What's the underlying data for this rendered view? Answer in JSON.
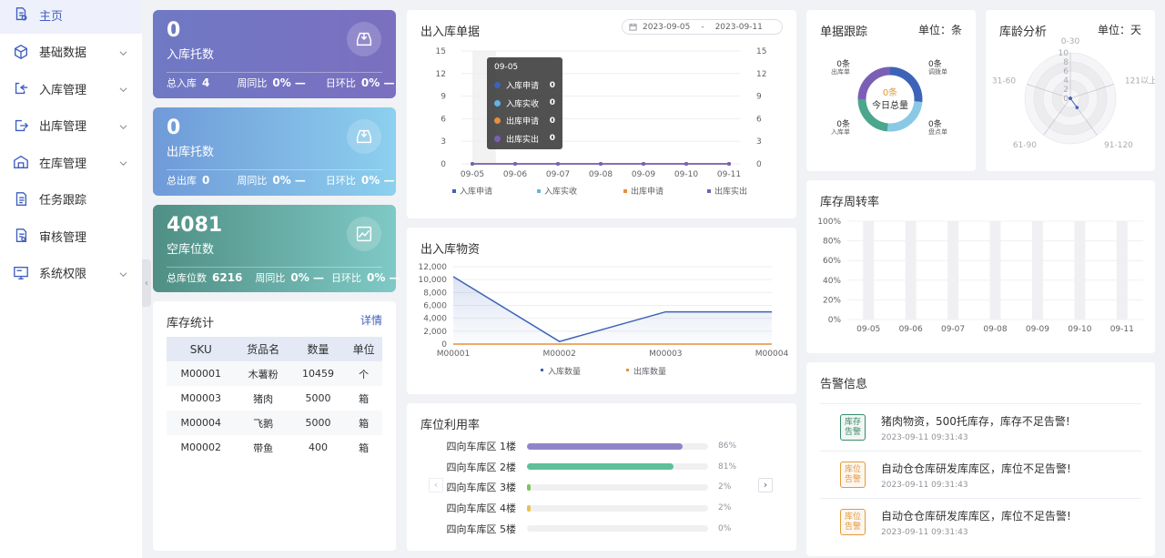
{
  "sidebar": {
    "items": [
      {
        "label": "主页",
        "icon": "home-doc-icon",
        "active": true,
        "has_chevron": false
      },
      {
        "label": "基础数据",
        "icon": "cube-icon",
        "active": false,
        "has_chevron": true
      },
      {
        "label": "入库管理",
        "icon": "inbound-icon",
        "active": false,
        "has_chevron": true
      },
      {
        "label": "出库管理",
        "icon": "outbound-icon",
        "active": false,
        "has_chevron": true
      },
      {
        "label": "在库管理",
        "icon": "warehouse-icon",
        "active": false,
        "has_chevron": true
      },
      {
        "label": "任务跟踪",
        "icon": "task-doc-icon",
        "active": false,
        "has_chevron": false
      },
      {
        "label": "审核管理",
        "icon": "audit-doc-icon",
        "active": false,
        "has_chevron": false
      },
      {
        "label": "系统权限",
        "icon": "system-monitor-icon",
        "active": false,
        "has_chevron": true
      }
    ],
    "collapse_glyph": "‹"
  },
  "stats": {
    "inbound": {
      "value": "0",
      "label": "入库托数",
      "total_label": "总入库",
      "total": "4",
      "wow_label": "周同比",
      "wow": "0% —",
      "dod_label": "日环比",
      "dod": "0% —"
    },
    "outbound": {
      "value": "0",
      "label": "出库托数",
      "total_label": "总出库",
      "total": "0",
      "wow_label": "周同比",
      "wow": "0% —",
      "dod_label": "日环比",
      "dod": "0% —"
    },
    "empty": {
      "value": "4081",
      "label": "空库位数",
      "total_label": "总库位数",
      "total": "6216",
      "wow_label": "周同比",
      "wow": "0% —",
      "dod_label": "日环比",
      "dod": "0% —"
    }
  },
  "inventory": {
    "title": "库存统计",
    "detail": "详情",
    "headers": [
      "SKU",
      "货品名",
      "数量",
      "单位"
    ],
    "rows": [
      [
        "M00001",
        "木薯粉",
        "10459",
        "个"
      ],
      [
        "M00003",
        "猪肉",
        "5000",
        "箱"
      ],
      [
        "M00004",
        "飞鹅",
        "5000",
        "箱"
      ],
      [
        "M00002",
        "带鱼",
        "400",
        "箱"
      ]
    ]
  },
  "doc_chart": {
    "title": "出入库单据",
    "date_start": "2023-09-05",
    "date_sep": "-",
    "date_end": "2023-09-11",
    "tooltip": {
      "date": "09-05",
      "rows": [
        {
          "name": "入库申请",
          "value": "0",
          "color": "#3c63b8"
        },
        {
          "name": "入库实收",
          "value": "0",
          "color": "#5eb5e6"
        },
        {
          "name": "出库申请",
          "value": "0",
          "color": "#e88f3c"
        },
        {
          "name": "出库实出",
          "value": "0",
          "color": "#7a5fb5"
        }
      ]
    }
  },
  "goods_chart": {
    "title": "出入库物资"
  },
  "util": {
    "title": "库位利用率",
    "rows": [
      {
        "label": "四向车库区 1楼",
        "pct_text": "86%",
        "value": 0.86,
        "color": "#8e85c9"
      },
      {
        "label": "四向车库区 2楼",
        "pct_text": "81%",
        "value": 0.81,
        "color": "#5dc09a"
      },
      {
        "label": "四向车库区 3楼",
        "pct_text": "2%",
        "value": 0.02,
        "color": "#7dc25c"
      },
      {
        "label": "四向车库区 4楼",
        "pct_text": "2%",
        "value": 0.02,
        "color": "#e8c24c"
      },
      {
        "label": "四向车库区 5楼",
        "pct_text": "0%",
        "value": 0.0,
        "color": "#cfd2d8"
      }
    ],
    "prev_glyph": "‹",
    "next_glyph": "›"
  },
  "tracking": {
    "title": "单据跟踪",
    "unit": "单位：条",
    "center_value": "0条",
    "center_label": "今日总量",
    "labels": [
      {
        "value": "0条",
        "name": "出库单"
      },
      {
        "value": "0条",
        "name": "入库单"
      },
      {
        "value": "0条",
        "name": "调拨单"
      },
      {
        "value": "0条",
        "name": "盘点单"
      }
    ]
  },
  "age": {
    "title": "库龄分析",
    "unit": "单位：天",
    "axes": [
      "0-30",
      "121以上",
      "91-120",
      "61-90",
      "31-60"
    ],
    "ticks": [
      "10",
      "8",
      "6",
      "4",
      "2",
      "0"
    ]
  },
  "turnover": {
    "title": "库存周转率"
  },
  "alerts": {
    "title": "告警信息",
    "items": [
      {
        "badge": "库存告警",
        "text": "猪肉物资，500托库存，库存不足告警!",
        "time": "2023-09-11 09:31:43",
        "color": "#3a8a6a"
      },
      {
        "badge": "库位告警",
        "text": "自动仓仓库研发库库区，库位不足告警!",
        "time": "2023-09-11 09:31:43",
        "color": "#e09a3e"
      },
      {
        "badge": "库位告警",
        "text": "自动仓仓库研发库库区，库位不足告警!",
        "time": "2023-09-11 09:31:43",
        "color": "#e09a3e"
      }
    ]
  },
  "chart_data": [
    {
      "type": "line",
      "x": [
        "09-05",
        "09-06",
        "09-07",
        "09-08",
        "09-09",
        "09-10",
        "09-11"
      ],
      "series": [
        {
          "name": "入库申请",
          "values": [
            0,
            0,
            0,
            0,
            0,
            0,
            0
          ],
          "color": "#3c63b8"
        },
        {
          "name": "入库实收",
          "values": [
            0,
            0,
            0,
            0,
            0,
            0,
            0
          ],
          "color": "#5eb5e6"
        },
        {
          "name": "出库申请",
          "values": [
            0,
            0,
            0,
            0,
            0,
            0,
            0
          ],
          "color": "#e88f3c"
        },
        {
          "name": "出库实出",
          "values": [
            0,
            0,
            0,
            0,
            0,
            0,
            0
          ],
          "color": "#7a5fb5"
        }
      ],
      "yticks": [
        0,
        3,
        6,
        9,
        12,
        15
      ],
      "ylim": [
        0,
        15
      ]
    },
    {
      "type": "area",
      "x": [
        "M00001",
        "M00002",
        "M00003",
        "M00004"
      ],
      "series": [
        {
          "name": "入库数量",
          "values": [
            10459,
            400,
            5000,
            5000
          ],
          "color": "#3c63b8"
        },
        {
          "name": "出库数量",
          "values": [
            0,
            0,
            0,
            0
          ],
          "color": "#e88f3c"
        }
      ],
      "yticks": [
        "0",
        "2,000",
        "4,000",
        "6,000",
        "8,000",
        "10,000",
        "12,000"
      ],
      "ylim": [
        0,
        12000
      ]
    },
    {
      "type": "bar",
      "categories": [
        "09-05",
        "09-06",
        "09-07",
        "09-08",
        "09-09",
        "09-10",
        "09-11"
      ],
      "values": [
        0,
        0,
        0,
        0,
        0,
        0,
        0
      ],
      "yticks": [
        "0%",
        "20%",
        "40%",
        "60%",
        "80%",
        "100%"
      ],
      "ylim": [
        0,
        100
      ]
    },
    {
      "type": "pie",
      "name": "单据跟踪",
      "categories": [
        "入库单",
        "出库单",
        "调拨单",
        "盘点单"
      ],
      "values": [
        0,
        0,
        0,
        0
      ],
      "colors": [
        "#3c63b8",
        "#8ac9e6",
        "#4aa68c",
        "#7a5fb5"
      ]
    },
    {
      "type": "radar",
      "name": "库龄分析",
      "categories": [
        "0-30",
        "121以上",
        "91-120",
        "61-90",
        "31-60"
      ],
      "values": [
        0,
        0,
        2.5,
        0,
        0
      ],
      "rmax": 10
    }
  ]
}
